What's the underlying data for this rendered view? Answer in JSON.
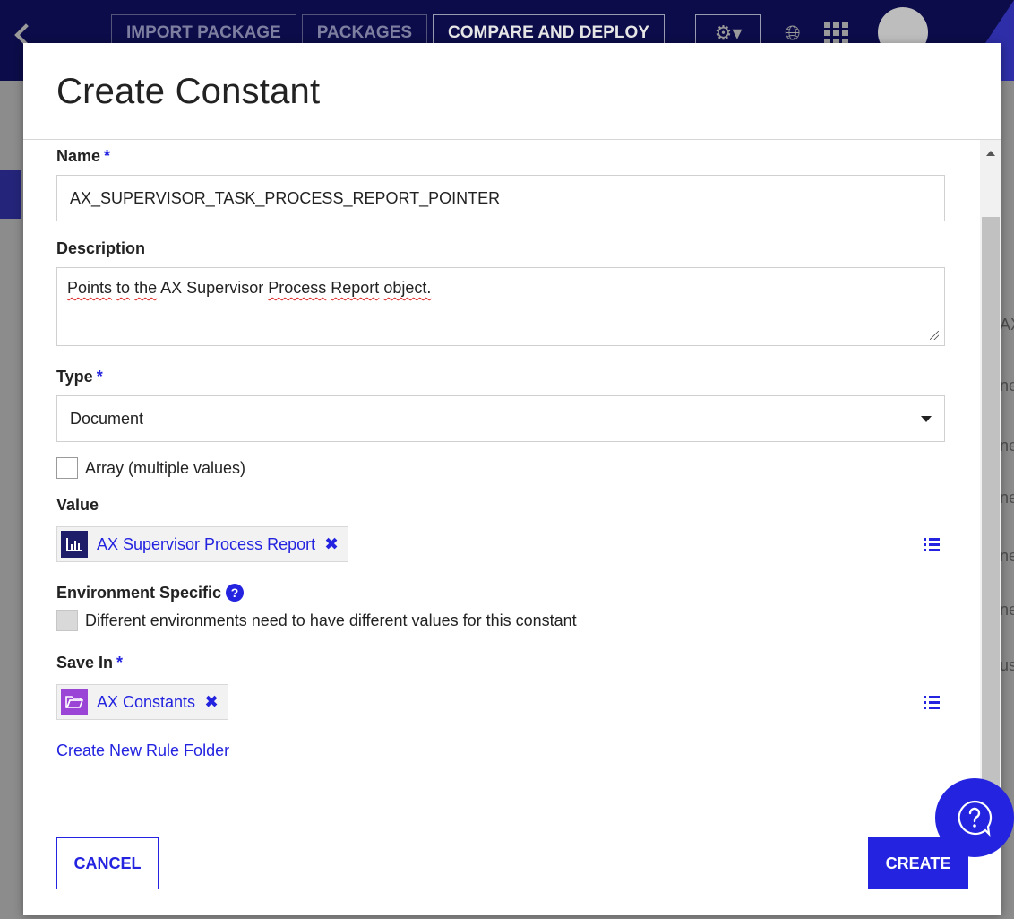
{
  "background": {
    "nav_buttons": [
      "IMPORT PACKAGE",
      "PACKAGES",
      "COMPARE AND DEPLOY"
    ],
    "edge_text": [
      "AX",
      "ne",
      "ne",
      "ne",
      "ne",
      "ne",
      "us"
    ]
  },
  "dialog": {
    "title": "Create Constant",
    "name": {
      "label": "Name",
      "required_mark": "*",
      "value": "AX_SUPERVISOR_TASK_PROCESS_REPORT_POINTER"
    },
    "description": {
      "label": "Description",
      "value_words": [
        "Points",
        "to",
        "the",
        "AX",
        "Supervisor",
        "Process",
        "Report",
        "object."
      ]
    },
    "type": {
      "label": "Type",
      "required_mark": "*",
      "selected": "Document"
    },
    "array_checkbox": {
      "label": "Array (multiple values)",
      "checked": false
    },
    "value": {
      "label": "Value",
      "chip_label": "AX Supervisor Process Report",
      "chip_close": "✖"
    },
    "environment_specific": {
      "label": "Environment Specific",
      "help_glyph": "?",
      "checkbox_label": "Different environments need to have different values for this constant",
      "checked": false
    },
    "save_in": {
      "label": "Save In",
      "required_mark": "*",
      "chip_label": "AX Constants",
      "chip_close": "✖"
    },
    "create_folder_link": "Create New Rule Folder",
    "cancel_label": "CANCEL",
    "create_label": "CREATE"
  },
  "colors": {
    "accent": "#2323e0",
    "header": "#0c0c4a",
    "report_icon_bg": "#1d1d6a",
    "folder_icon_bg": "#9b45d6"
  }
}
